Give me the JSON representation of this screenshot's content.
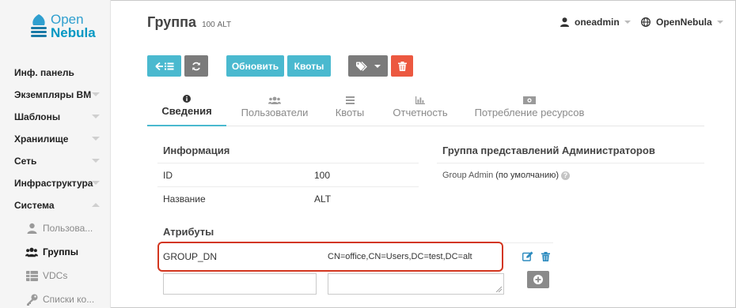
{
  "brand": {
    "line1": "Open",
    "line2": "Nebula"
  },
  "header": {
    "title": "Группа",
    "subtitle": "100 ALT",
    "user": "oneadmin",
    "zone": "OpenNebula"
  },
  "sidebar": {
    "items": [
      {
        "label": "Инф. панель"
      },
      {
        "label": "Экземпляры ВМ"
      },
      {
        "label": "Шаблоны"
      },
      {
        "label": "Хранилище"
      },
      {
        "label": "Сеть"
      },
      {
        "label": "Инфраструктура"
      },
      {
        "label": "Система"
      }
    ],
    "subitems": [
      {
        "label": "Пользова..."
      },
      {
        "label": "Группы"
      },
      {
        "label": "VDCs"
      },
      {
        "label": "Списки ко..."
      }
    ]
  },
  "toolbar": {
    "update_label": "Обновить",
    "quotas_label": "Квоты"
  },
  "tabs": [
    {
      "label": "Сведения"
    },
    {
      "label": "Пользователи"
    },
    {
      "label": "Квоты"
    },
    {
      "label": "Отчетность"
    },
    {
      "label": "Потребление ресурсов"
    }
  ],
  "info": {
    "heading": "Информация",
    "rows": [
      {
        "key": "ID",
        "value": "100"
      },
      {
        "key": "Название",
        "value": "ALT"
      }
    ]
  },
  "views": {
    "heading": "Группа представлений Администраторов",
    "view_name": "Group Admin",
    "default_label": "(по умолчанию)"
  },
  "attributes": {
    "heading": "Атрибуты",
    "rows": [
      {
        "key": "GROUP_DN",
        "value": "CN=office,CN=Users,DC=test,DC=alt"
      }
    ]
  },
  "colors": {
    "accent": "#4ab9cf",
    "danger": "#ec5840",
    "highlight": "#d3361f"
  }
}
